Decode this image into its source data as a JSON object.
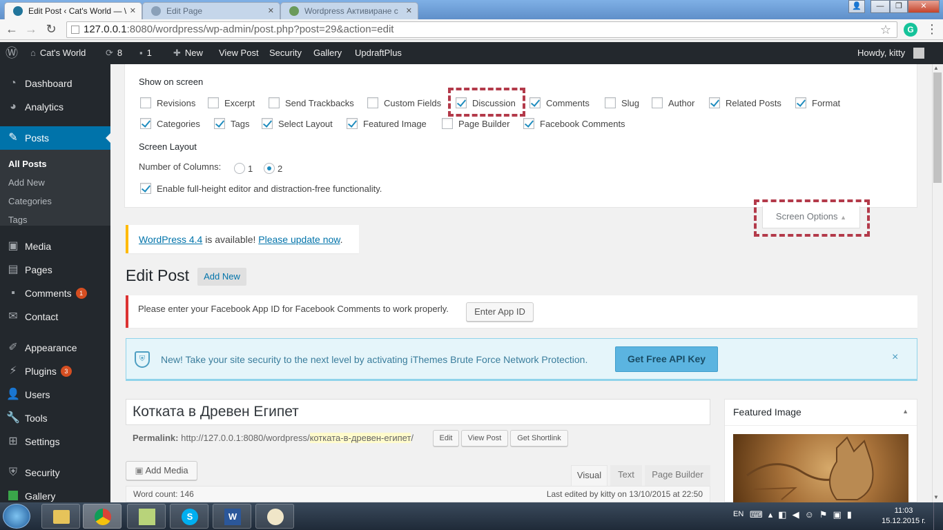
{
  "browser": {
    "tabs": [
      {
        "title": "Edit Post ‹ Cat's World — \\"
      },
      {
        "title": "Edit Page"
      },
      {
        "title": "Wordpress Активиране с"
      }
    ],
    "url_host": "127.0.0.1",
    "url_path": ":8080/wordpress/wp-admin/post.php?post=29&action=edit"
  },
  "adminbar": {
    "site": "Cat's World",
    "updates": "8",
    "comments": "1",
    "new": "New",
    "view_post": "View Post",
    "security": "Security",
    "gallery": "Gallery",
    "updraft": "UpdraftPlus",
    "howdy": "Howdy, kitty"
  },
  "sidebar": {
    "items": [
      {
        "label": "Dashboard"
      },
      {
        "label": "Analytics"
      },
      {
        "label": "Posts"
      },
      {
        "label": "Media"
      },
      {
        "label": "Pages"
      },
      {
        "label": "Comments",
        "badge": "1"
      },
      {
        "label": "Contact"
      },
      {
        "label": "Appearance"
      },
      {
        "label": "Plugins",
        "badge": "3"
      },
      {
        "label": "Users"
      },
      {
        "label": "Tools"
      },
      {
        "label": "Settings"
      },
      {
        "label": "Security"
      },
      {
        "label": "Gallery"
      }
    ],
    "submenu": [
      "All Posts",
      "Add New",
      "Categories",
      "Tags"
    ]
  },
  "screen_options": {
    "show_on_screen": "Show on screen",
    "row1": [
      {
        "label": "Revisions",
        "checked": false
      },
      {
        "label": "Excerpt",
        "checked": false
      },
      {
        "label": "Send Trackbacks",
        "checked": false
      },
      {
        "label": "Custom Fields",
        "checked": false
      },
      {
        "label": "Discussion",
        "checked": true
      },
      {
        "label": "Comments",
        "checked": true
      },
      {
        "label": "Slug",
        "checked": false
      },
      {
        "label": "Author",
        "checked": false
      },
      {
        "label": "Related Posts",
        "checked": true
      },
      {
        "label": "Format",
        "checked": true
      }
    ],
    "row2": [
      {
        "label": "Categories",
        "checked": true
      },
      {
        "label": "Tags",
        "checked": true
      },
      {
        "label": "Select Layout",
        "checked": true
      },
      {
        "label": "Featured Image",
        "checked": true
      },
      {
        "label": "Page Builder",
        "checked": false
      },
      {
        "label": "Facebook Comments",
        "checked": true
      }
    ],
    "screen_layout": "Screen Layout",
    "columns_label": "Number of Columns:",
    "col1": "1",
    "col2": "2",
    "fullheight": "Enable full-height editor and distraction-free functionality.",
    "toggle": "Screen Options"
  },
  "update_notice": {
    "link1": "WordPress 4.4",
    "mid": " is available! ",
    "link2": "Please update now",
    "end": "."
  },
  "heading": {
    "title": "Edit Post",
    "add_new": "Add New"
  },
  "fb_notice": {
    "text": "Please enter your Facebook App ID for Facebook Comments to work properly.",
    "button": "Enter App ID"
  },
  "ithemes": {
    "text": "New! Take your site security to the next level by activating iThemes Brute Force Network Protection.",
    "button": "Get Free API Key",
    "close": "×"
  },
  "post": {
    "title": "Котката в Древен Египет",
    "permalink_label": "Permalink:",
    "permalink_base": "http://127.0.0.1:8080/wordpress/",
    "permalink_slug": "котката-в-древен-египет",
    "permalink_end": "/",
    "edit": "Edit",
    "view_post": "View Post",
    "shortlink": "Get Shortlink",
    "add_media": "Add Media",
    "tab_visual": "Visual",
    "tab_text": "Text",
    "tab_pb": "Page Builder",
    "wordcount": "Word count: 146",
    "lastedited": "Last edited by kitty on 13/10/2015 at 22:50"
  },
  "featured": {
    "title": "Featured Image"
  },
  "taskbar": {
    "lang": "EN",
    "time": "11:03",
    "date": "15.12.2015 г."
  }
}
